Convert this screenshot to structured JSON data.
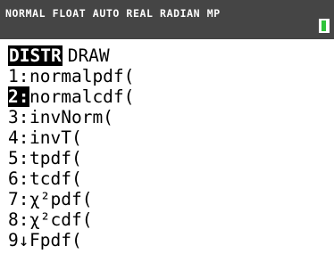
{
  "status_bar": {
    "modes": "NORMAL FLOAT AUTO REAL RADIAN MP",
    "battery_icon": "battery-icon",
    "battery_color": "#2fc43a"
  },
  "menu": {
    "tabs": [
      {
        "label": "DISTR",
        "active": true
      },
      {
        "label": "DRAW",
        "active": false
      }
    ],
    "items": [
      {
        "num": "1:",
        "label": "normalpdf("
      },
      {
        "num": "2:",
        "label": "normalcdf(",
        "selected": true
      },
      {
        "num": "3:",
        "label": "invNorm("
      },
      {
        "num": "4:",
        "label": "invT("
      },
      {
        "num": "5:",
        "label": "tpdf("
      },
      {
        "num": "6:",
        "label": "tcdf("
      },
      {
        "num": "7:",
        "label": "χ²pdf("
      },
      {
        "num": "8:",
        "label": "χ²cdf("
      },
      {
        "num": "9↓",
        "label": "Fpdf("
      }
    ]
  },
  "colors": {
    "status_background": "#454545",
    "selection": "#000000"
  }
}
